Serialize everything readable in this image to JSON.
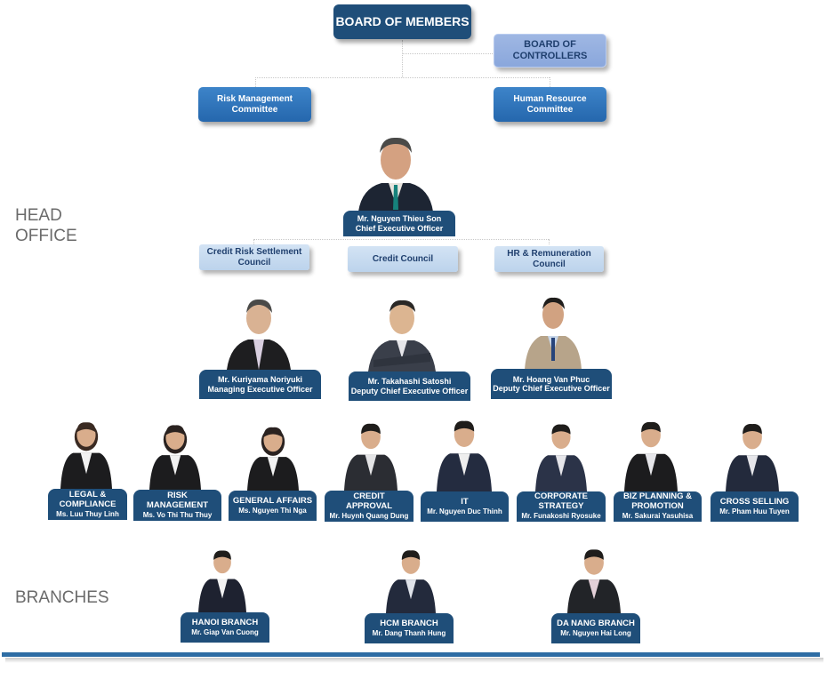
{
  "sections": {
    "head_office": [
      "HEAD",
      "OFFICE"
    ],
    "branches": "BRANCHES"
  },
  "board": {
    "members": "BOARD OF MEMBERS",
    "controllers": [
      "BOARD OF",
      "CONTROLLERS"
    ],
    "risk_committee": [
      "Risk Management",
      "Committee"
    ],
    "hr_committee": [
      "Human Resource",
      "Committee"
    ]
  },
  "ceo": {
    "name": "Mr. Nguyen Thieu Son",
    "title": "Chief Executive Officer"
  },
  "councils": [
    {
      "lines": [
        "Credit Risk Settlement",
        "Council"
      ]
    },
    {
      "lines": [
        "Credit  Council"
      ]
    },
    {
      "lines": [
        "HR & Remuneration",
        "Council"
      ]
    }
  ],
  "executives": [
    {
      "name": "Mr. Kuriyama Noriyuki",
      "title": "Managing Executive Officer"
    },
    {
      "name": "Mr. Takahashi Satoshi",
      "title": "Deputy Chief Executive Officer"
    },
    {
      "name": "Mr. Hoang Van Phuc",
      "title": "Deputy Chief Executive Officer"
    }
  ],
  "departments": [
    {
      "dept": [
        "LEGAL &",
        "COMPLIANCE"
      ],
      "head": "Ms. Luu Thuy Linh"
    },
    {
      "dept": [
        "RISK",
        "MANAGEMENT"
      ],
      "head": "Ms. Vo Thi Thu Thuy"
    },
    {
      "dept": [
        "GENERAL AFFAIRS"
      ],
      "head": "Ms. Nguyen Thi Nga"
    },
    {
      "dept": [
        "CREDIT",
        "APPROVAL"
      ],
      "head": "Mr. Huynh Quang Dung"
    },
    {
      "dept": [
        "IT"
      ],
      "head": "Mr. Nguyen Duc Thinh"
    },
    {
      "dept": [
        "CORPORATE",
        "STRATEGY"
      ],
      "head": "Mr. Funakoshi Ryosuke"
    },
    {
      "dept": [
        "BIZ PLANNING &",
        "PROMOTION"
      ],
      "head": "Mr. Sakurai Yasuhisa"
    },
    {
      "dept": [
        "CROSS SELLING"
      ],
      "head": "Mr. Pham Huu Tuyen"
    }
  ],
  "branches": [
    {
      "name": "HANOI BRANCH",
      "head": "Mr. Giap Van Cuong"
    },
    {
      "name": "HCM BRANCH",
      "head": "Mr. Dang Thanh Hung"
    },
    {
      "name": "DA NANG BRANCH",
      "head": "Mr. Nguyen Hai Long"
    }
  ],
  "colors": {
    "dark_blue": "#1f4e79",
    "mid_blue": "#2e75b6",
    "light_blue": "#bcd3ec",
    "controllers": "#8eaadb",
    "bottom_bar": "#2e6da4"
  }
}
